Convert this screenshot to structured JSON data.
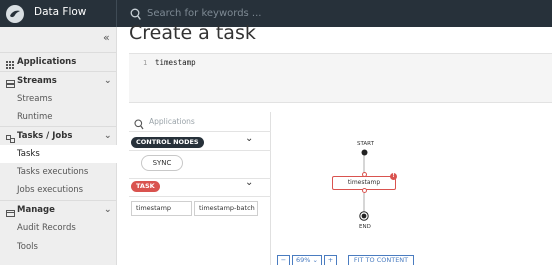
{
  "header": {
    "brand": "Data Flow",
    "search_placeholder": "Search for keywords ..."
  },
  "sidebar": {
    "collapse_glyph": "«",
    "items": [
      {
        "label": "Applications",
        "type": "group",
        "icon": "grid-icon"
      },
      {
        "label": "Streams",
        "type": "group",
        "icon": "streams-icon"
      },
      {
        "label": "Streams",
        "type": "sub"
      },
      {
        "label": "Runtime",
        "type": "sub"
      },
      {
        "label": "Tasks / Jobs",
        "type": "group",
        "icon": "tasks-icon"
      },
      {
        "label": "Tasks",
        "type": "sub",
        "active": true
      },
      {
        "label": "Tasks executions",
        "type": "sub"
      },
      {
        "label": "Jobs executions",
        "type": "sub"
      },
      {
        "label": "Manage",
        "type": "group",
        "icon": "manage-icon"
      },
      {
        "label": "Audit Records",
        "type": "sub"
      },
      {
        "label": "Tools",
        "type": "sub"
      }
    ]
  },
  "page": {
    "title": "Create a task"
  },
  "editor": {
    "line_number": "1",
    "code": "timestamp"
  },
  "palette": {
    "search_placeholder": "Applications",
    "control_nodes_label": "CONTROL NODES",
    "sync_label": "SYNC",
    "task_label": "TASK",
    "apps": [
      "timestamp",
      "timestamp-batch"
    ]
  },
  "graph": {
    "start_label": "START",
    "task_node_label": "timestamp",
    "error_badge": "!",
    "end_label": "END"
  },
  "zoom": {
    "minus": "−",
    "value": "69%",
    "caret": "⌄",
    "plus": "+",
    "fit_label": "FIT TO CONTENT"
  },
  "colors": {
    "topbar": "#27313a",
    "accent_red": "#d9534f",
    "accent_blue": "#4a7cc0"
  }
}
